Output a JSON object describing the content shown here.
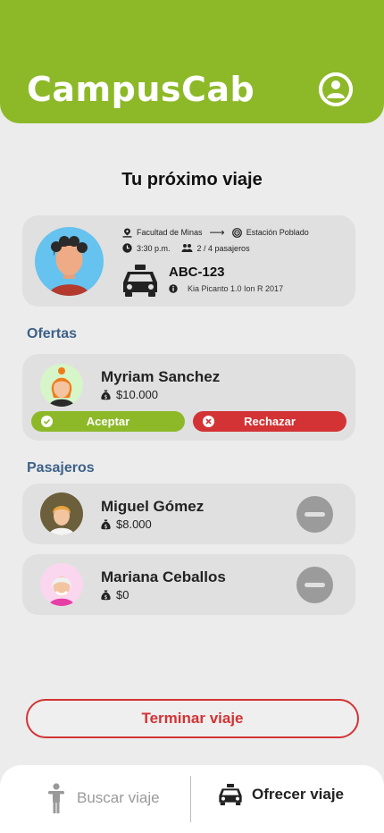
{
  "app": {
    "title": "CampusCab"
  },
  "trip": {
    "section_title": "Tu próximo viaje",
    "origin": "Facultad de Minas",
    "arrow": "⟶",
    "destination": "Estación Poblado",
    "time": "3:30 p.m.",
    "seats": "2 / 4 pasajeros",
    "plate": "ABC-123",
    "car_model": "Kia Picanto 1.0 Ion R 2017"
  },
  "offers": {
    "label": "Ofertas",
    "items": [
      {
        "name": "Myriam Sanchez",
        "price": "$10.000",
        "accept_label": "Aceptar",
        "reject_label": "Rechazar"
      }
    ]
  },
  "passengers": {
    "label": "Pasajeros",
    "items": [
      {
        "name": "Miguel Gómez",
        "price": "$8.000"
      },
      {
        "name": "Mariana Ceballos",
        "price": "$0"
      }
    ]
  },
  "actions": {
    "end_trip": "Terminar viaje"
  },
  "nav": {
    "search_label": "Buscar viaje",
    "offer_label": "Ofrecer viaje"
  },
  "colors": {
    "brand_green": "#8db929",
    "danger_red": "#d33335",
    "label_blue": "#3d6189",
    "card_gray": "#e0e0e0",
    "background": "#ececec"
  },
  "icons": [
    "user-icon",
    "location-pin-icon",
    "radar-icon",
    "clock-icon",
    "group-icon",
    "taxi-icon",
    "info-icon",
    "money-bag-icon",
    "check-icon",
    "x-icon",
    "minus-icon",
    "person-icon"
  ]
}
